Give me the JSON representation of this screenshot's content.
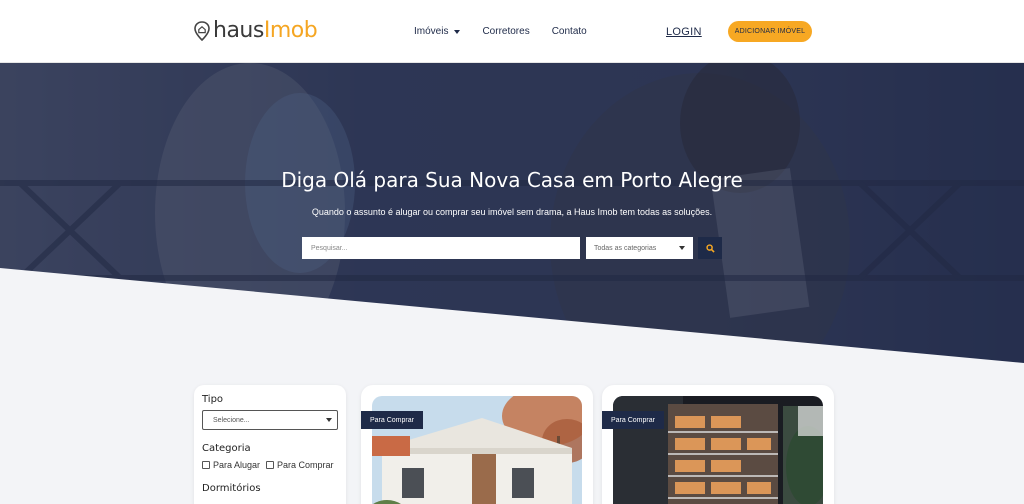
{
  "brand": {
    "name_part1": "haus",
    "name_part2": "Imob",
    "accent": "#f7a823",
    "navy": "#1e2a48"
  },
  "nav": {
    "items": [
      {
        "label": "Imóveis",
        "has_dropdown": true
      },
      {
        "label": "Corretores",
        "has_dropdown": false
      },
      {
        "label": "Contato",
        "has_dropdown": false
      }
    ],
    "login_label": "LOGIN",
    "add_label": "ADICIONAR IMÓVEL"
  },
  "hero": {
    "title": "Diga Olá para Sua Nova Casa em Porto Alegre",
    "subtitle": "Quando o assunto é alugar ou comprar seu imóvel sem drama, a Haus Imob tem todas as soluções.",
    "search_placeholder": "Pesquisar...",
    "category_selected": "Todas as categorias",
    "search_icon": "search-icon"
  },
  "filters": {
    "tipo_label": "Tipo",
    "tipo_selected": "Selecione...",
    "categoria_label": "Categoria",
    "categoria_options": [
      "Para Alugar",
      "Para Comprar"
    ],
    "dormitorios_label": "Dormitórios"
  },
  "listings": [
    {
      "badge": "Para Comprar",
      "image": "house-photo"
    },
    {
      "badge": "Para Comprar",
      "image": "building-photo"
    }
  ]
}
